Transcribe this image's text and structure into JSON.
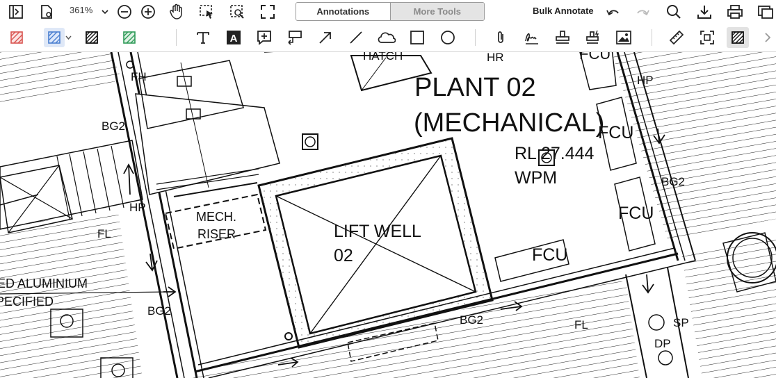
{
  "toolbar": {
    "zoom": "361%",
    "tab_annotations": "Annotations",
    "tab_more_tools": "More Tools",
    "bulk_annotate": "Bulk Annotate"
  },
  "drawing": {
    "plant_line1": "PLANT 02",
    "plant_line2": "(MECHANICAL)",
    "rl": "RL 27.444",
    "wpm": "WPM",
    "lift_line1": "LIFT WELL",
    "lift_line2": "02",
    "mech_line1": "MECH.",
    "mech_line2": "RISER",
    "fcu": "FCU",
    "hatch": "HATCH",
    "hr": "HR",
    "hp": "HP",
    "fh": "FH",
    "bg2": "BG2",
    "fl": "FL",
    "sp": "SP",
    "dp": "DP",
    "alum1": "ED ALUMINIUM",
    "alum2": "PECIFIED"
  },
  "colors": {
    "red_hatch": "#d9534f",
    "blue_hatch": "#4a7fd0",
    "green_hatch": "#2e9a57",
    "active_bg": "#dfe8f7"
  }
}
